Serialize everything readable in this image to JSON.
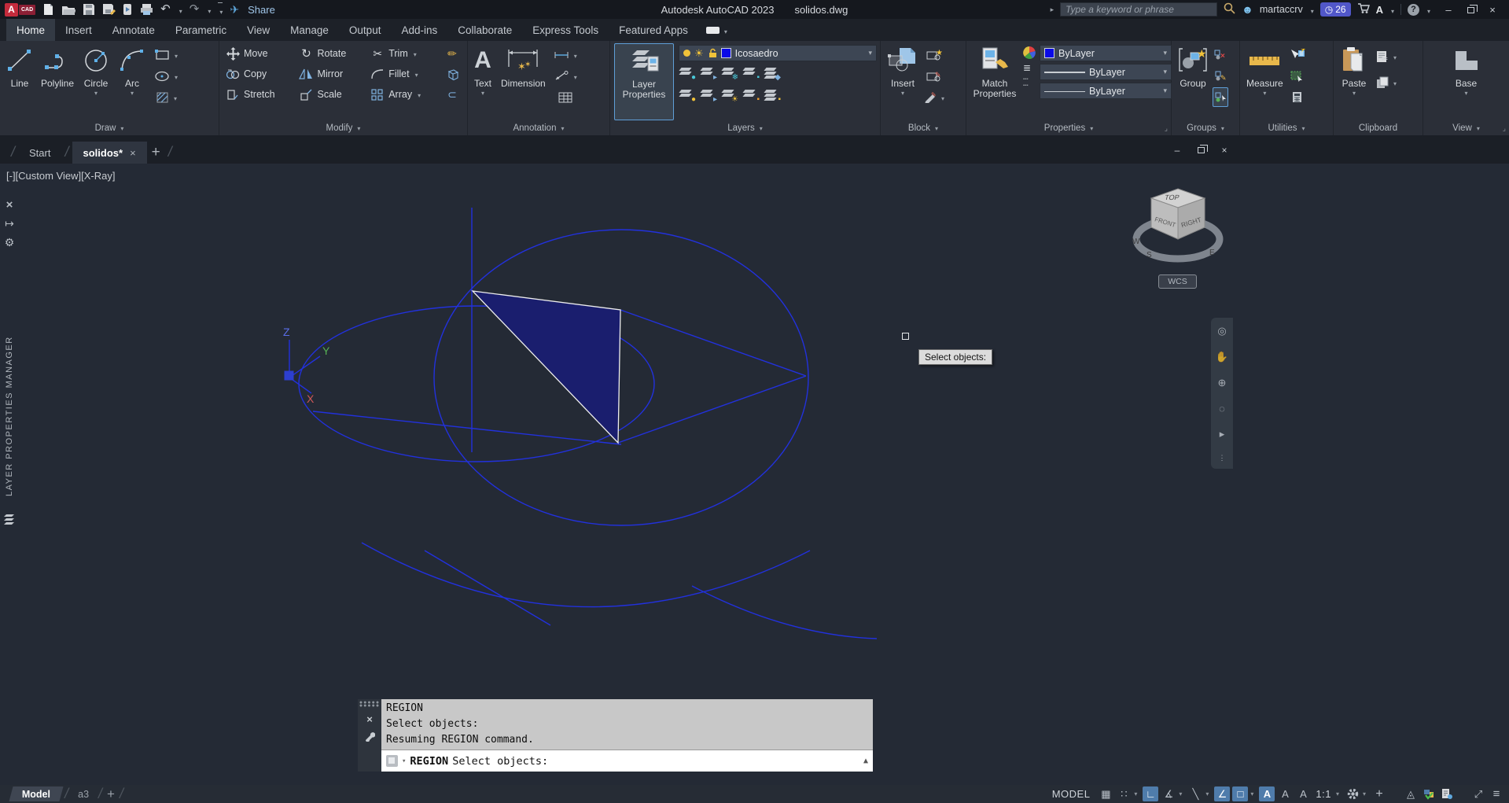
{
  "titlebar": {
    "title": "Autodesk AutoCAD 2023",
    "doc_name": "solidos.dwg",
    "share_label": "Share",
    "search_placeholder": "Type a keyword or phrase",
    "username": "martaccrv",
    "badge_count": "26"
  },
  "ribbon": {
    "tabs": [
      "Home",
      "Insert",
      "Annotate",
      "Parametric",
      "View",
      "Manage",
      "Output",
      "Add-ins",
      "Collaborate",
      "Express Tools",
      "Featured Apps"
    ],
    "active_tab": "Home",
    "draw": {
      "label": "Draw",
      "line": "Line",
      "polyline": "Polyline",
      "circle": "Circle",
      "arc": "Arc"
    },
    "modify": {
      "label": "Modify",
      "move": "Move",
      "rotate": "Rotate",
      "trim": "Trim",
      "copy": "Copy",
      "mirror": "Mirror",
      "fillet": "Fillet",
      "stretch": "Stretch",
      "scale": "Scale",
      "array": "Array"
    },
    "annotation": {
      "label": "Annotation",
      "text": "Text",
      "dimension": "Dimension"
    },
    "layers": {
      "label": "Layers",
      "layer_properties": "Layer Properties",
      "current_layer": "Icosaedro"
    },
    "block": {
      "label": "Block",
      "insert": "Insert"
    },
    "properties": {
      "label": "Properties",
      "match": "Match Properties",
      "color": "ByLayer",
      "lineweight": "ByLayer",
      "linetype": "ByLayer"
    },
    "groups": {
      "label": "Groups",
      "group": "Group"
    },
    "utilities": {
      "label": "Utilities",
      "measure": "Measure"
    },
    "clipboard": {
      "label": "Clipboard",
      "paste": "Paste"
    },
    "view": {
      "label": "View",
      "base": "Base"
    }
  },
  "file_tabs": {
    "start": "Start",
    "active_doc": "solidos*"
  },
  "viewport": {
    "controls_label": "[-][Custom View][X-Ray]",
    "tooltip": "Select objects:",
    "ucs": {
      "x": "X",
      "y": "Y",
      "z": "Z"
    },
    "viewcube": {
      "top": "TOP",
      "front": "FRONT",
      "right": "RIGHT",
      "w": "W",
      "s": "S",
      "e": "E",
      "wcs": "WCS"
    }
  },
  "palette": {
    "title": "LAYER PROPERTIES MANAGER"
  },
  "command_line": {
    "history": [
      "REGION",
      "Select objects:",
      "Resuming REGION command."
    ],
    "prompt_command": "REGION",
    "prompt_message": "Select objects:"
  },
  "status_bar": {
    "model_tab": "Model",
    "layout_tab": "a3",
    "space": "MODEL",
    "annotation_scale": "1:1"
  },
  "icons": {
    "caret-down": "▾",
    "close": "×",
    "search": "magnifier",
    "user": "person-silhouette",
    "clock": "◷",
    "grid": "▦",
    "snap": "∷",
    "ortho": "∟",
    "polar": "∡",
    "isodraft": "╲",
    "otrack": "∠",
    "osnap": "□",
    "menu": "≡",
    "clean-screen": "⤢"
  },
  "colors": {
    "geometry_blue": "#2231dd",
    "selection_fill": "#1a1e6e",
    "highlight_white": "#eeeeee",
    "active_toggle_blue": "#4f7cab",
    "badge_indigo": "#5157c9",
    "layer_swatch_blue": "#0a0ae6"
  }
}
